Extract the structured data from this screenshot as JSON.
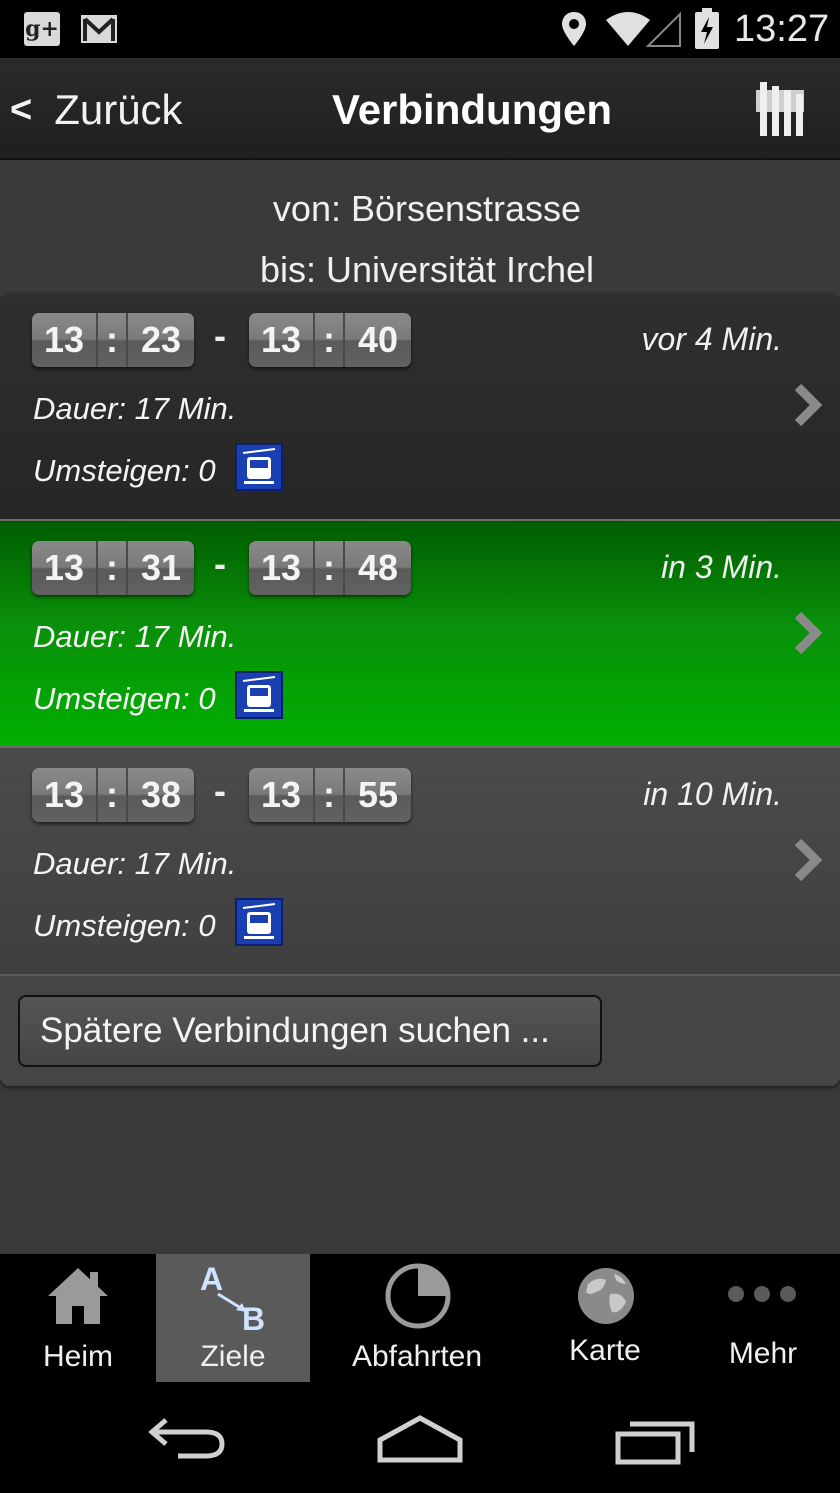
{
  "status_bar": {
    "time": "13:27",
    "icons": [
      "google-plus-icon",
      "gmail-icon",
      "location-icon",
      "wifi-icon",
      "signal-icon",
      "battery-charging-icon"
    ]
  },
  "action_bar": {
    "back_chevron": "<",
    "back_label": "Zurück",
    "title": "Verbindungen",
    "right_icon": "timetable-icon"
  },
  "route": {
    "from": "von: Börsenstrasse",
    "to": "bis: Universität Irchel"
  },
  "connections": [
    {
      "dep_h": "13",
      "dep_m": "23",
      "arr_h": "13",
      "arr_m": "40",
      "relative": "vor 4 Min.",
      "duration": "Dauer: 17 Min.",
      "transfers": "Umsteigen: 0",
      "mode_icon": "tram-icon",
      "highlighted": false
    },
    {
      "dep_h": "13",
      "dep_m": "31",
      "arr_h": "13",
      "arr_m": "48",
      "relative": "in 3 Min.",
      "duration": "Dauer: 17 Min.",
      "transfers": "Umsteigen: 0",
      "mode_icon": "tram-icon",
      "highlighted": true
    },
    {
      "dep_h": "13",
      "dep_m": "38",
      "arr_h": "13",
      "arr_m": "55",
      "relative": "in 10 Min.",
      "duration": "Dauer: 17 Min.",
      "transfers": "Umsteigen: 0",
      "mode_icon": "tram-icon",
      "highlighted": false
    }
  ],
  "clock_separator": ":",
  "range_separator": "-",
  "later_button": "Spätere Verbindungen suchen ...",
  "tabs": [
    {
      "label": "Heim",
      "icon": "home-icon",
      "active": false
    },
    {
      "label": "Ziele",
      "icon": "a-to-b-icon",
      "active": true
    },
    {
      "label": "Abfahrten",
      "icon": "clock-icon",
      "active": false
    },
    {
      "label": "Karte",
      "icon": "globe-icon",
      "active": false
    },
    {
      "label": "Mehr",
      "icon": "more-dots-icon",
      "active": false
    }
  ],
  "a_to_b": {
    "a": "A",
    "b": "B"
  },
  "nav_bar": {
    "icons": [
      "back-icon",
      "home-icon",
      "recents-icon"
    ]
  },
  "colors": {
    "highlight_green": "#00b000",
    "tram_icon_blue": "#1a3fb0",
    "active_tab_bg": "#5a5a5a"
  }
}
